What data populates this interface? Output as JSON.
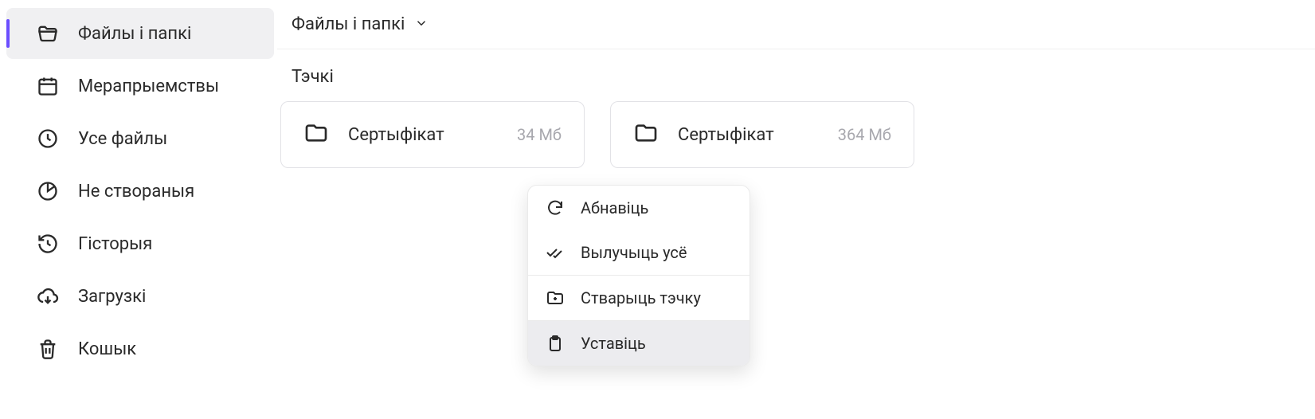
{
  "sidebar": {
    "items": [
      {
        "label": "Файлы і папкі",
        "icon": "folder-open",
        "active": true
      },
      {
        "label": "Мерапрыемствы",
        "icon": "calendar",
        "active": false
      },
      {
        "label": "Усе файлы",
        "icon": "clock",
        "active": false
      },
      {
        "label": "Не створаныя",
        "icon": "pie",
        "active": false
      },
      {
        "label": "Гісторыя",
        "icon": "history",
        "active": false
      },
      {
        "label": "Загрузкі",
        "icon": "download-cloud",
        "active": false
      },
      {
        "label": "Кошык",
        "icon": "trash",
        "active": false
      }
    ]
  },
  "breadcrumb": {
    "label": "Файлы і папкі"
  },
  "section": {
    "title": "Тэчкі"
  },
  "folders": [
    {
      "name": "Сертыфікат",
      "size": "34 Мб"
    },
    {
      "name": "Сертыфікат",
      "size": "364 Мб"
    }
  ],
  "context_menu": {
    "items": [
      {
        "label": "Абнавіць",
        "icon": "refresh"
      },
      {
        "label": "Вылучыць усё",
        "icon": "check-all"
      },
      {
        "label": "Стварыць тэчку",
        "icon": "folder-plus"
      },
      {
        "label": "Уставіць",
        "icon": "clipboard",
        "hover": true
      }
    ]
  }
}
